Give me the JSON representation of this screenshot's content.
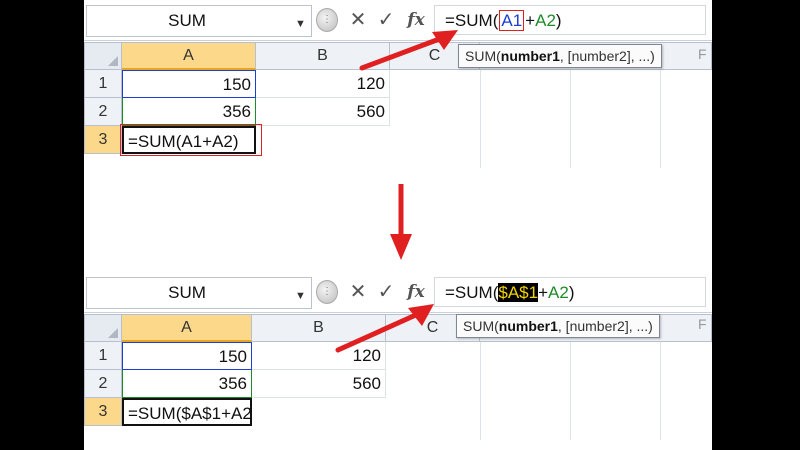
{
  "top": {
    "name_box": "SUM",
    "formula": {
      "prefix": "=SUM(",
      "ref1": "A1",
      "plus": "+",
      "ref2": "A2",
      "suffix": ")"
    },
    "tooltip": {
      "func": "SUM(",
      "arg1": "number1",
      "rest": ", [number2], ...)"
    },
    "tooltip_tail": "F",
    "columns": [
      "A",
      "B",
      "C"
    ],
    "rows": [
      "1",
      "2",
      "3"
    ],
    "cells": {
      "a1": "150",
      "b1": "120",
      "a2": "356",
      "b2": "560",
      "a3": "=SUM(A1+A2)"
    }
  },
  "bottom": {
    "name_box": "SUM",
    "formula": {
      "prefix": "=SUM(",
      "ref1": "$A$1",
      "plus": "+",
      "ref2": "A2",
      "suffix": ")"
    },
    "tooltip": {
      "func": "SUM(",
      "arg1": "number1",
      "rest": ", [number2], ...)"
    },
    "tooltip_tail": "F",
    "columns": [
      "A",
      "B",
      "C"
    ],
    "rows": [
      "1",
      "2",
      "3"
    ],
    "cells": {
      "a1": "150",
      "b1": "120",
      "a2": "356",
      "b2": "560",
      "a3": "=SUM($A$1+A2"
    }
  },
  "icons": {
    "cancel": "✕",
    "enter": "✓",
    "dropdown": "▼",
    "grip": "⋮"
  },
  "fx_label": "fx",
  "colors": {
    "ref_blue": "#1b3fd4",
    "ref_green": "#1f8b2a",
    "annotation_red": "#e02020",
    "header_selected": "#fbd88a"
  }
}
